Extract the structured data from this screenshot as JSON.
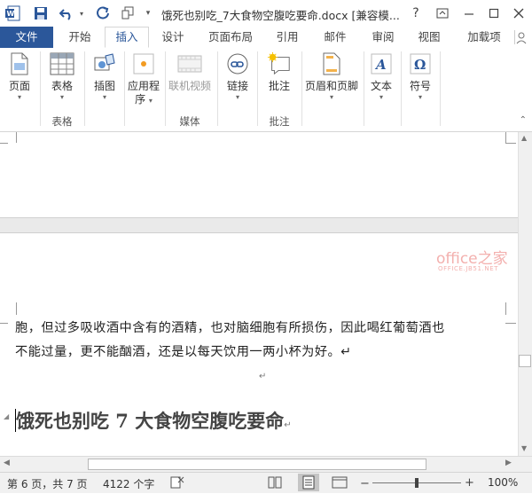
{
  "window": {
    "title": "饿死也别吃_7大食物空腹吃要命.docx [兼容模...",
    "help": "?"
  },
  "tabs": [
    "文件",
    "开始",
    "插入",
    "设计",
    "页面布局",
    "引用",
    "邮件",
    "审阅",
    "视图",
    "加载项"
  ],
  "ribbon": {
    "buttons": {
      "page": "页面",
      "table": "表格",
      "illustrations": "插图",
      "apps": "应用程",
      "apps2": "序",
      "online_video": "联机视频",
      "links": "链接",
      "comment": "批注",
      "header_footer": "页眉和页脚",
      "text": "文本",
      "symbols": "符号"
    },
    "groups": {
      "tables": "表格",
      "media": "媒体",
      "comments": "批注"
    }
  },
  "document": {
    "para_line1": "胞，但过多吸收酒中含有的酒精，也对脑细胞有所损伤，因此喝红葡萄酒也",
    "para_line2": "不能过量，更不能酗酒，还是以每天饮用一两小杯为好。↵",
    "empty_mark": "↵",
    "heading": "饿死也别吃 7 大食物空腹吃要命",
    "heading_mark": "↵"
  },
  "watermark": {
    "main": "office之家",
    "sub": "OFFICE.JB51.NET"
  },
  "status": {
    "page": "第 6 页，共 7 页",
    "words": "4122 个字",
    "zoom": "100%"
  }
}
